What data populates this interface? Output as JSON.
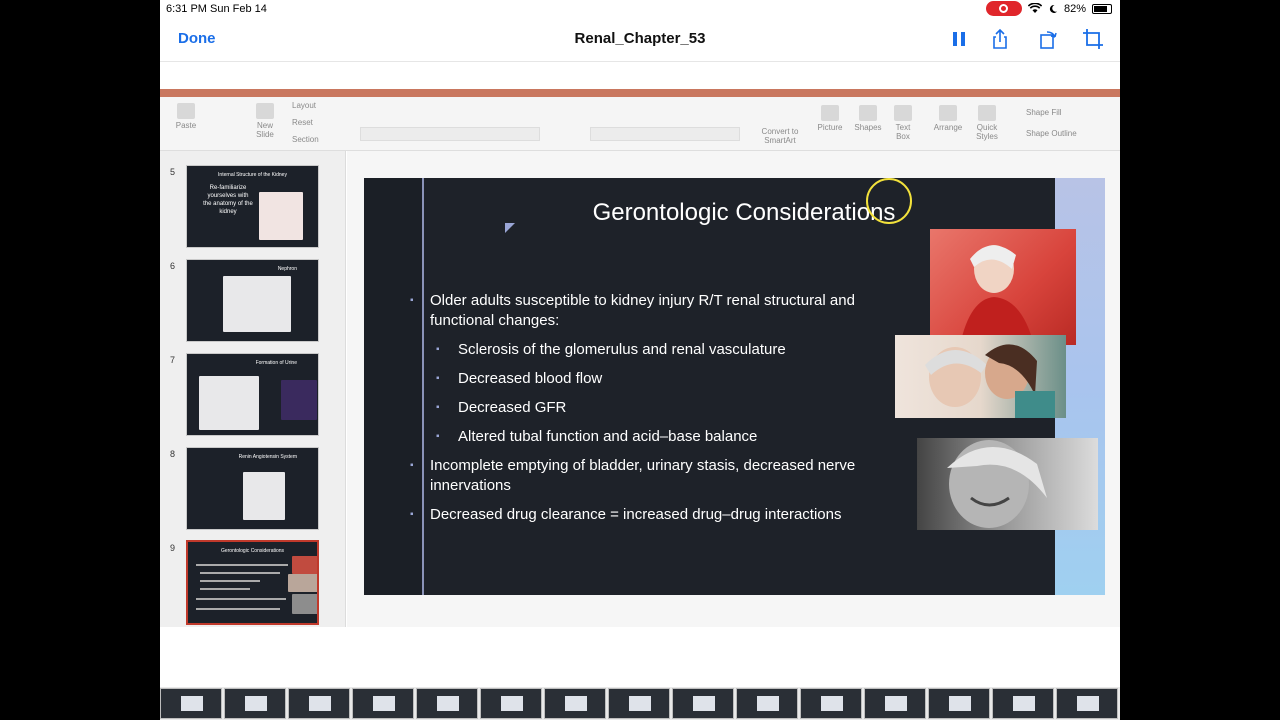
{
  "status_bar": {
    "time_date": "6:31 PM  Sun Feb 14",
    "battery_label": "82%",
    "battery_level": 0.82
  },
  "nav": {
    "done_label": "Done",
    "title": "Renal_Chapter_53"
  },
  "ribbon": {
    "tools": [
      {
        "label": "Paste"
      },
      {
        "label": "New\nSlide"
      },
      {
        "label": "Layout"
      },
      {
        "label": "Reset"
      },
      {
        "label": "Section"
      },
      {
        "label": "Convert to\nSmartArt"
      },
      {
        "label": "Picture"
      },
      {
        "label": "Shapes"
      },
      {
        "label": "Text\nBox"
      },
      {
        "label": "Arrange"
      },
      {
        "label": "Quick\nStyles"
      },
      {
        "label": "Shape Fill"
      },
      {
        "label": "Shape Outline"
      }
    ]
  },
  "thumbnails": [
    {
      "number": "5",
      "title": "Internal Structure of the Kidney",
      "text": "Re-familiarize yourselves with the anatomy of the kidney"
    },
    {
      "number": "6",
      "title": "Nephron",
      "text": ""
    },
    {
      "number": "7",
      "title": "Formation of Urine",
      "text": ""
    },
    {
      "number": "8",
      "title": "Renin Angiotensin System",
      "text": ""
    },
    {
      "number": "9",
      "title": "Gerontologic Considerations",
      "text": ""
    }
  ],
  "slide": {
    "title": "Gerontologic Considerations",
    "bullets": [
      {
        "level": 1,
        "text": "Older adults susceptible to kidney injury R/T renal structural and functional changes:"
      },
      {
        "level": 2,
        "text": "Sclerosis of the glomerulus and renal vasculature"
      },
      {
        "level": 2,
        "text": "Decreased blood flow"
      },
      {
        "level": 2,
        "text": "Decreased GFR"
      },
      {
        "level": 2,
        "text": "Altered tubal function and acid–base balance"
      },
      {
        "level": 1,
        "text": "Incomplete emptying of bladder, urinary stasis, decreased nerve innervations"
      },
      {
        "level": 1,
        "text": "Decreased drug clearance = increased drug–drug interactions"
      }
    ]
  },
  "colors": {
    "accent": "#1a6ee8",
    "slide_bg": "#1e2229",
    "selected_border": "#c0392b",
    "record": "#e0262b"
  }
}
